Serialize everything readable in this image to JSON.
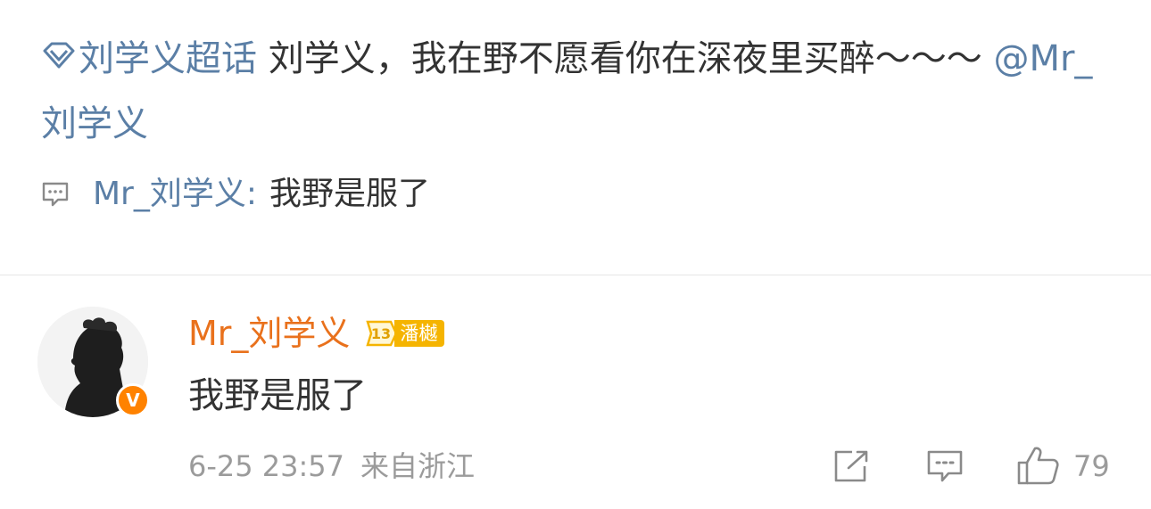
{
  "post": {
    "topic": "刘学义超话",
    "text": " 刘学义，我在野不愿看你在深夜里买醉～～～",
    "mention": "@Mr_刘学义"
  },
  "repost": {
    "name": "Mr_刘学义",
    "colon": ":",
    "text": "我野是服了"
  },
  "comment": {
    "username": "Mr_刘学义",
    "level": "13",
    "level_name": "潘樾",
    "text": "我野是服了",
    "date": "6-25 23:57",
    "location": "来自浙江",
    "likes": "79"
  },
  "colors": {
    "link": "#5b7fa6",
    "username": "#e9711c",
    "badge": "#f5b400",
    "verified": "#ff8200"
  },
  "icons": [
    "topic-diamond-icon",
    "comment-icon",
    "verified-icon",
    "share-icon",
    "comment-icon",
    "like-icon"
  ]
}
